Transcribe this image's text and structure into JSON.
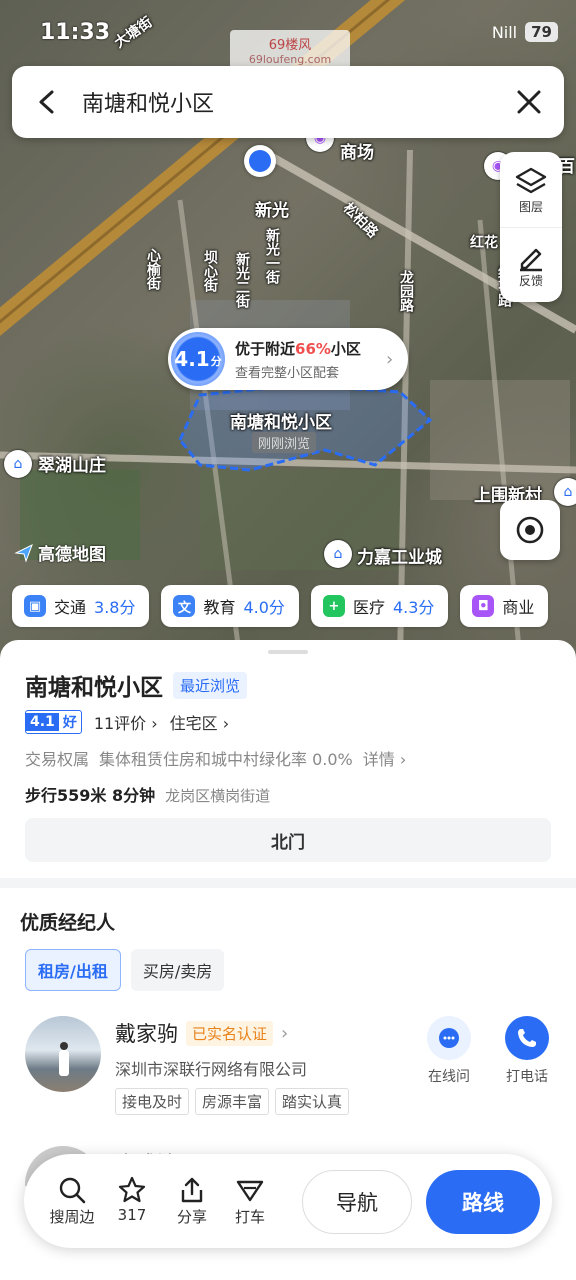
{
  "status": {
    "time": "11:33",
    "network": "Nill",
    "battery": "79"
  },
  "watermark": {
    "title": "69楼风",
    "url": "69loufeng.com"
  },
  "search": {
    "query": "南塘和悦小区"
  },
  "map": {
    "labels": {
      "xinguang": "新光",
      "shangchang": "商场",
      "songbai_road": "松柏路",
      "xinguang_1st": "新光一街",
      "xinguang_2nd": "新光二街",
      "xinyu_st": "心榆街",
      "bahe_st": "坝心街",
      "cuihu": "翠湖山庄",
      "shangwei": "上围新村",
      "lijia": "力嘉工业城",
      "hongxing": "红花",
      "baihuo": "百",
      "xiecuo": "塘",
      "dabeijie": "大塘街",
      "honghua_road": "红花路",
      "longyuan": "龙园路",
      "community": "南塘和悦小区",
      "just_viewed": "刚刚浏览"
    },
    "logo": "高德地图"
  },
  "tools": {
    "layers": "图层",
    "feedback": "反馈"
  },
  "score_bubble": {
    "score": "4.1",
    "unit": "分",
    "prefix": "优于附近",
    "percent": "66%",
    "suffix": "小区",
    "subtitle": "查看完整小区配套"
  },
  "chips": [
    {
      "icon": "交",
      "label": "交通",
      "value": "3.8分",
      "color": "#3b82f6"
    },
    {
      "icon": "文",
      "label": "教育",
      "value": "4.0分",
      "color": "#3b82f6"
    },
    {
      "icon": "+",
      "label": "医疗",
      "value": "4.3分",
      "color": "#22c55e"
    },
    {
      "icon": "商",
      "label": "商业",
      "value": "",
      "color": "#a855f7"
    }
  ],
  "place": {
    "name": "南塘和悦小区",
    "recent_tag": "最近浏览",
    "rating": "4.1",
    "rating_label": "好",
    "reviews": "11评价",
    "category": "住宅区",
    "info_label": "交易权属",
    "info_value": "集体租赁住房和城中村绿化率 0.0%",
    "details": "详情",
    "walk": "步行559米 8分钟",
    "district": "龙岗区横岗街道",
    "gate": "北门"
  },
  "agents": {
    "title": "优质经纪人",
    "tabs": [
      "租房/出租",
      "买房/卖房"
    ],
    "list": [
      {
        "name": "戴家驹",
        "verified": "已实名认证",
        "company": "深圳市深联行网络有限公司",
        "tags": [
          "接电及时",
          "房源丰富",
          "踏实认真"
        ],
        "chat": "在线问",
        "call": "打电话"
      },
      {
        "name": "许成涛"
      }
    ]
  },
  "bottom": {
    "nearby": "搜周边",
    "favorites": "317",
    "share": "分享",
    "taxi": "打车",
    "navigate": "导航",
    "route": "路线"
  }
}
